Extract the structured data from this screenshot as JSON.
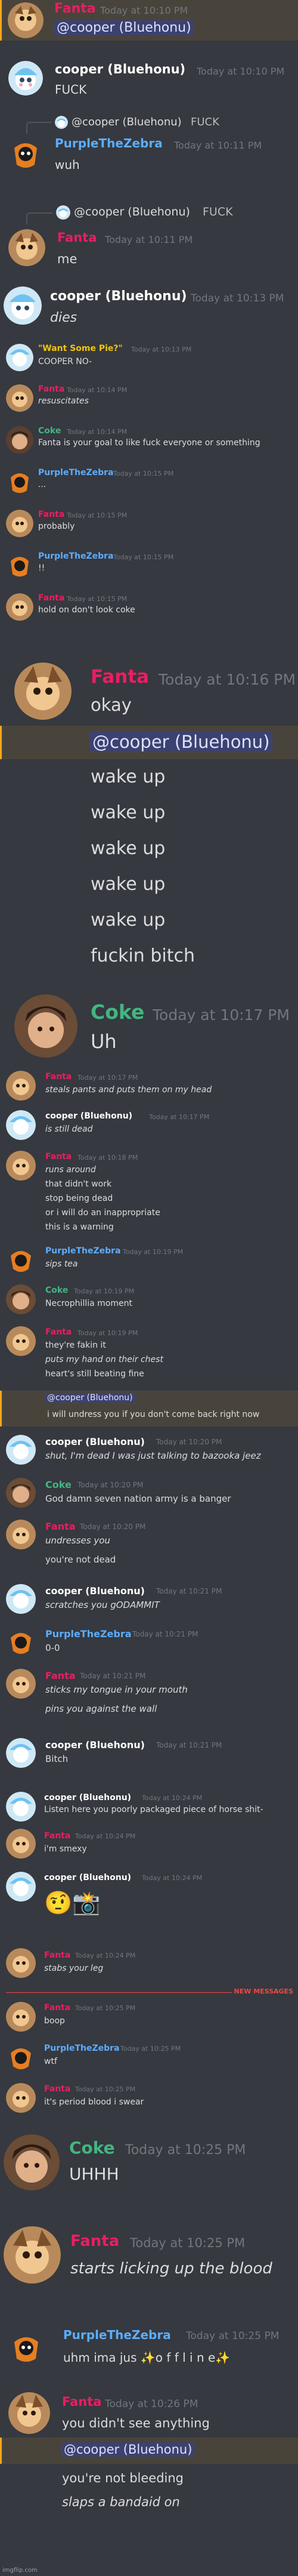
{
  "users": {
    "fanta": {
      "name": "Fanta",
      "color": "#e91e63"
    },
    "cooper": {
      "name": "cooper (Bluehonu)",
      "color": "#ffffff"
    },
    "purple": {
      "name": "PurpleTheZebra",
      "color": "#5cadff"
    },
    "coke": {
      "name": "Coke",
      "color": "#43b581"
    },
    "wantsome": {
      "name": "\"Want Some Pie?\"",
      "color": "#f1c40f"
    }
  },
  "shot1": {
    "m1": {
      "name": "Fanta",
      "ts": "Today at 10:10 PM",
      "mention": "@cooper (Bluehonu)"
    },
    "m2": {
      "name": "cooper (Bluehonu)",
      "ts": "Today at 10:10 PM",
      "text": "FUCK"
    },
    "m3": {
      "reply_name": "@cooper (Bluehonu)",
      "reply_text": "FUCK",
      "name": "PurpleTheZebra",
      "ts": "Today at 10:11 PM",
      "text": "wuh"
    }
  },
  "shot2": {
    "reply_name": "@cooper (Bluehonu)",
    "reply_text": "FUCK",
    "name": "Fanta",
    "ts": "Today at 10:11 PM",
    "text": "me"
  },
  "shot3": {
    "name": "cooper (Bluehonu)",
    "ts": "Today at 10:13 PM",
    "text": "dies"
  },
  "shot4": [
    {
      "name": "\"Want Some Pie?\"",
      "ts": "Today at 10:13 PM",
      "text": "COOPER NO-"
    },
    {
      "name": "Fanta",
      "ts": "Today at 10:14 PM",
      "text": "resuscitates"
    },
    {
      "name": "Coke",
      "ts": "Today at 10:14 PM",
      "text": "Fanta is your goal to like fuck everyone or something"
    },
    {
      "name": "PurpleTheZebra",
      "ts": "Today at 10:15 PM",
      "text": "..."
    },
    {
      "name": "Fanta",
      "ts": "Today at 10:15 PM",
      "text": "probably"
    },
    {
      "name": "PurpleTheZebra",
      "ts": "Today at 10:15 PM",
      "text": "!!"
    },
    {
      "name": "Fanta",
      "ts": "Today at 10:15 PM",
      "text": "hold on don't look coke"
    }
  ],
  "shot5": {
    "name": "Fanta",
    "ts": "Today at 10:16 PM",
    "text": "okay",
    "mention": "@cooper (Bluehonu)",
    "lines": [
      "wake up",
      "wake up",
      "wake up",
      "wake up",
      "wake up",
      "fuckin bitch"
    ]
  },
  "shot6": {
    "name": "Coke",
    "ts": "Today at 10:17 PM",
    "text": "Uh"
  },
  "shot7": [
    {
      "name": "Fanta",
      "ts": "Today at 10:17 PM",
      "lines": [
        "steals pants and puts them on my head"
      ]
    },
    {
      "name": "cooper (Bluehonu)",
      "ts": "Today at 10:17 PM",
      "lines": [
        "is still dead"
      ]
    },
    {
      "name": "Fanta",
      "ts": "Today at 10:18 PM",
      "lines": [
        "runs around",
        "that didn't work",
        "stop being dead",
        "or i will do an inappropriate",
        "this is a warning"
      ]
    },
    {
      "name": "PurpleTheZebra",
      "ts": "Today at 10:19 PM",
      "lines": [
        "sips tea"
      ]
    },
    {
      "name": "Coke",
      "ts": "Today at 10:19 PM",
      "lines": [
        "Necrophillia moment"
      ]
    },
    {
      "name": "Fanta",
      "ts": "Today at 10:19 PM",
      "lines": [
        "they're fakin it",
        "puts my hand on their chest",
        "heart's still beating fine"
      ]
    }
  ],
  "shot7b": {
    "mention": "@cooper (Bluehonu)",
    "text": "i will undress you if you don't come back right now"
  },
  "shot8": [
    {
      "name": "cooper (Bluehonu)",
      "ts": "Today at 10:20 PM",
      "lines": [
        "shut, I'm dead I was just talking to bazooka jeez"
      ]
    },
    {
      "name": "Coke",
      "ts": "Today at 10:20 PM",
      "lines": [
        "God damn seven nation army is a banger"
      ]
    },
    {
      "name": "Fanta",
      "ts": "Today at 10:20 PM",
      "lines": [
        "undresses you",
        "you're not dead"
      ]
    },
    {
      "name": "cooper (Bluehonu)",
      "ts": "Today at 10:21 PM",
      "lines": [
        "scratches you gODAMMIT"
      ]
    },
    {
      "name": "PurpleTheZebra",
      "ts": "Today at 10:21 PM",
      "lines": [
        "0-0"
      ]
    },
    {
      "name": "Fanta",
      "ts": "Today at 10:21 PM",
      "lines": [
        "sticks my tongue in your mouth",
        "pins you against the wall"
      ]
    },
    {
      "name": "cooper (Bluehonu)",
      "ts": "Today at 10:21 PM",
      "lines": [
        "Bitch"
      ]
    }
  ],
  "shot9": [
    {
      "name": "cooper (Bluehonu)",
      "ts": "Today at 10:24 PM",
      "lines": [
        "Listen here you poorly packaged piece of horse shit-"
      ]
    },
    {
      "name": "Fanta",
      "ts": "Today at 10:24 PM",
      "lines": [
        "i'm smexy"
      ]
    },
    {
      "name": "cooper (Bluehonu)",
      "ts": "Today at 10:24 PM",
      "lines": [
        ""
      ]
    },
    {
      "name": "Fanta",
      "ts": "Today at 10:24 PM",
      "lines": [
        "stabs your leg"
      ]
    }
  ],
  "shot10": {
    "new_messages": "NEW MESSAGES",
    "msgs": [
      {
        "name": "Fanta",
        "ts": "Today at 10:25 PM",
        "lines": [
          "boop"
        ]
      },
      {
        "name": "PurpleTheZebra",
        "ts": "Today at 10:25 PM",
        "lines": [
          "wtf"
        ]
      },
      {
        "name": "Fanta",
        "ts": "Today at 10:25 PM",
        "lines": [
          "it's period blood i swear"
        ]
      }
    ]
  },
  "shot11": {
    "name": "Coke",
    "ts": "Today at 10:25 PM",
    "text": "UHHH"
  },
  "shot12": {
    "name": "Fanta",
    "ts": "Today at 10:25 PM",
    "text": "starts licking up the blood"
  },
  "shot13": {
    "name": "PurpleTheZebra",
    "ts": "Today at 10:25 PM",
    "text": "uhm ima jus ✨o f f l i n e✨"
  },
  "shot14": {
    "name": "Fanta",
    "ts": "Today at 10:26 PM",
    "text": "you didn't see anything",
    "mention": "@cooper (Bluehonu)",
    "lines": [
      "you're not bleeding",
      "slaps a bandaid on"
    ]
  },
  "watermark": "imgflip.com"
}
